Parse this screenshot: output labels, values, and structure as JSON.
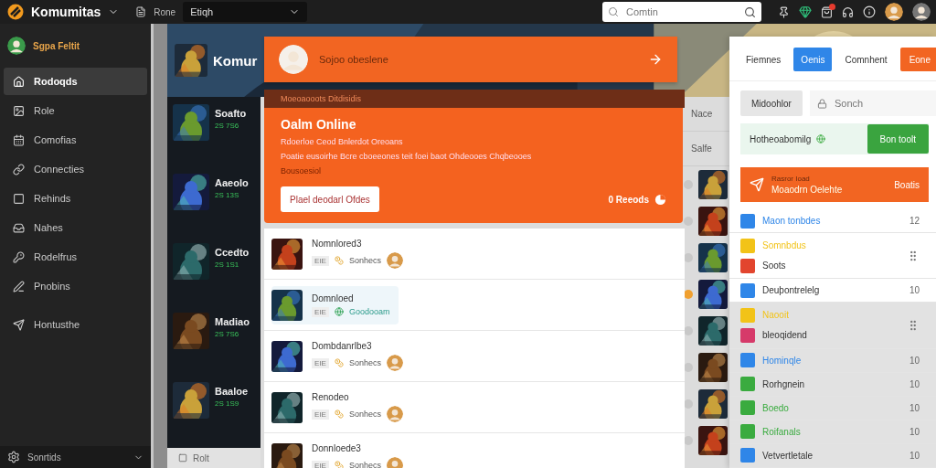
{
  "topbar": {
    "brand": "Komumitas",
    "nav_label": "Rone",
    "dropdown": "Etiqh",
    "search": {
      "placeholder": "Comtin"
    },
    "notification_badge": true
  },
  "sidebar": {
    "user": "Sgpa Feltit",
    "items": [
      {
        "label": "Rodoqds",
        "selected": true
      },
      {
        "label": "Role",
        "selected": false
      },
      {
        "label": "Comofias",
        "selected": false
      },
      {
        "label": "Connecties",
        "selected": false
      },
      {
        "label": "Rehinds",
        "selected": false
      },
      {
        "label": "Nahes",
        "selected": false
      },
      {
        "label": "Rodelfrus",
        "selected": false
      },
      {
        "label": "Pnobins",
        "selected": false
      },
      {
        "label": "Hontusthe",
        "selected": false
      }
    ],
    "footer": "Sonrtids"
  },
  "hero": {
    "title": "Komur"
  },
  "games": [
    {
      "title": "Soafto",
      "stats": "2S 7S6"
    },
    {
      "title": "Aaeolo",
      "stats": "2S 13S"
    },
    {
      "title": "Ccedto",
      "stats": "2S 1S1"
    },
    {
      "title": "Madiao",
      "stats": "2S 7S6"
    },
    {
      "title": "Baaloe",
      "stats": "2S 1S9"
    }
  ],
  "footer_link": "Rolt",
  "columns": {
    "heading": "Nace",
    "subheading": "Salfe"
  },
  "popup": {
    "header": "Sojoo obeslene",
    "band": "Moeoaooots Ditdisidis",
    "title": "Oalm Online",
    "subtitle": "Rdoerloe Ceod Bnlerdot Oreoans",
    "description": "Poatie eusoirhe Bcre cboeeones teit foei baot Ohdeooes Chqbeooes",
    "note": "Bousoesiol",
    "action": "Plael deodarl Ofdes",
    "reads": "0 Reeods",
    "rows": [
      {
        "title": "Nomnlored3",
        "tag": "EIE",
        "status": "Sonhecs",
        "highlighted": false
      },
      {
        "title": "Domnloed",
        "tag": "EIE",
        "status": "Goodooam",
        "highlighted": true
      },
      {
        "title": "Dombdanrlbe3",
        "tag": "EIE",
        "status": "Sonhecs",
        "highlighted": false
      },
      {
        "title": "Renodeo",
        "tag": "EIE",
        "status": "Sonhecs",
        "highlighted": false
      },
      {
        "title": "Donnloede3",
        "tag": "EIE",
        "status": "Sonhecs",
        "highlighted": false
      }
    ]
  },
  "side_panel": {
    "tabs": [
      {
        "label": "Fiemnes",
        "selected": false
      },
      {
        "label": "Oenis",
        "selected": true
      },
      {
        "label": "Comnhent",
        "selected": false
      }
    ],
    "tab_action": "Eone",
    "filter_button": "Midoohlor",
    "search": {
      "placeholder": "Sonch"
    },
    "notice": "Hotheoabomilg",
    "notice_action": "Bon toolt",
    "promo": {
      "eyebrow": "Rasror Ioad",
      "title": "Moaodrn Oelehte",
      "action": "Boatis"
    },
    "items": [
      {
        "kind": "single",
        "label": "Maon tonbdes",
        "count": "12",
        "color": "#2f86e8",
        "accent": true,
        "dimmed": false
      },
      {
        "kind": "pair",
        "label": "Somnbdus",
        "second": {
          "label": "Soots",
          "color": "#e2452e"
        },
        "color": "#f2c318",
        "accent": true,
        "dimmed": false
      },
      {
        "kind": "single",
        "label": "Deuþontrelelg",
        "count": "10",
        "color": "#2f86e8",
        "accent": false,
        "dimmed": false
      },
      {
        "kind": "pair",
        "label": "Naooit",
        "second": {
          "label": "bleoqidend",
          "color": "#d63a6a"
        },
        "color": "#f2c318",
        "accent": true,
        "dimmed": true
      },
      {
        "kind": "single",
        "label": "Hominqle",
        "count": "10",
        "color": "#2f86e8",
        "accent": true,
        "dimmed": true
      },
      {
        "kind": "single",
        "label": "Rorhgnein",
        "count": "10",
        "color": "#3aab3f",
        "accent": false,
        "dimmed": true
      },
      {
        "kind": "single",
        "label": "Boedo",
        "count": "10",
        "color": "#3aab3f",
        "accent": true,
        "dimmed": true
      },
      {
        "kind": "single",
        "label": "Roifanals",
        "count": "10",
        "color": "#3aab3f",
        "accent": true,
        "dimmed": true
      },
      {
        "kind": "single",
        "label": "Vetvertletale",
        "count": "10",
        "color": "#2f86e8",
        "accent": false,
        "dimmed": true
      }
    ]
  }
}
